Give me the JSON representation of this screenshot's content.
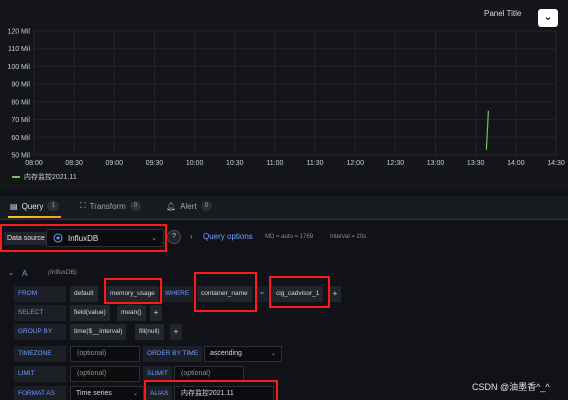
{
  "panel": {
    "title": "Panel Title",
    "collapse_icon": "chevron-down-icon"
  },
  "chart_data": {
    "type": "line",
    "title": "",
    "xlabel": "",
    "ylabel": "",
    "y_ticks": [
      "120 Mil",
      "110 Mil",
      "100 Mil",
      "90 Mil",
      "80 Mil",
      "70 Mil",
      "60 Mil",
      "50 Mil"
    ],
    "x_ticks": [
      "08:00",
      "08:30",
      "09:00",
      "09:30",
      "10:00",
      "10:30",
      "11:00",
      "11:30",
      "12:00",
      "12:30",
      "13:00",
      "13:30",
      "14:00",
      "14:30"
    ],
    "ylim": [
      50000000,
      120000000
    ],
    "series": [
      {
        "name": "内存监控2021.11",
        "color": "#73bf69",
        "x": [
          "13:38",
          "13:38"
        ],
        "values": [
          53000000,
          75000000
        ]
      }
    ],
    "grid": true,
    "legend": "bottom-left"
  },
  "tabs": [
    {
      "label": "Query",
      "count": "1",
      "icon": "database-icon",
      "active": true
    },
    {
      "label": "Transform",
      "count": "0",
      "icon": "transform-icon",
      "active": false
    },
    {
      "label": "Alert",
      "count": "0",
      "icon": "bell-icon",
      "active": false
    }
  ],
  "datasource": {
    "label": "Data source",
    "value": "InfluxDB",
    "help": "?",
    "query_options_label": "Query options",
    "md_info": "MD = auto = 1769",
    "interval_info": "Interval = 20s"
  },
  "query": {
    "name": "A",
    "datasource_hint": "(InfluxDB)",
    "from": {
      "label": "FROM",
      "policy": "default",
      "measurement": "memory_usage",
      "where_kw": "WHERE",
      "where_key": "container_name",
      "operator": "=",
      "where_value": "cig_cadvisor_1",
      "plus": "+"
    },
    "select": {
      "label": "SELECT",
      "field": "field(value)",
      "agg": "mean()",
      "plus": "+"
    },
    "group_by": {
      "label": "GROUP BY",
      "time": "time($__interval)",
      "fill": "fill(null)",
      "plus": "+"
    },
    "timezone": {
      "label": "TIMEZONE",
      "placeholder": "(optional)",
      "order_label": "ORDER BY TIME",
      "order_value": "ascending"
    },
    "limit": {
      "label": "LIMIT",
      "placeholder": "(optional)",
      "slimit_label": "SLIMIT",
      "slimit_placeholder": "(optional)"
    },
    "format": {
      "label": "FORMAT AS",
      "value": "Time series",
      "alias_label": "ALIAS",
      "alias_value": "内存监控2021.11"
    }
  },
  "watermark": "CSDN @油墨香^_^"
}
